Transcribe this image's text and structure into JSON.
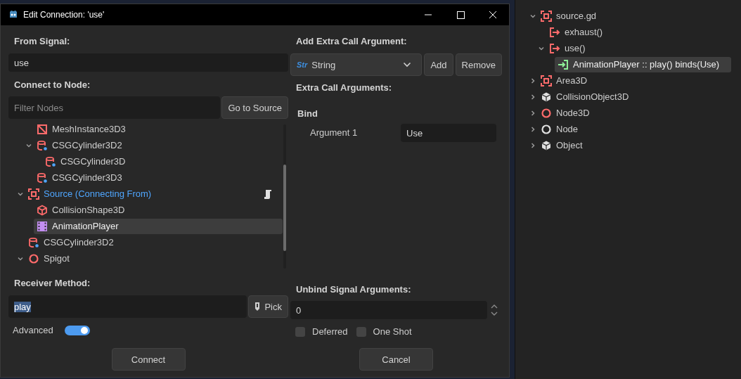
{
  "window": {
    "title": "Edit Connection: 'use'"
  },
  "from_signal": {
    "label": "From Signal:",
    "value": "use"
  },
  "connect_to_node": {
    "label": "Connect to Node:",
    "placeholder": "Filter Nodes",
    "go_to_source": "Go to Source"
  },
  "node_tree": {
    "items": [
      {
        "children": [
          {
            "label": "MeshInstance3D3",
            "kind": "mesh",
            "selected": false,
            "connecting_from": false,
            "has_script": false
          },
          {
            "label": "CSGCylinder3D2",
            "kind": "cylinder",
            "selected": false,
            "connecting_from": false,
            "has_script": false,
            "expanded": true,
            "children": [
              {
                "label": "CSGCylinder3D",
                "kind": "cylinder",
                "selected": false,
                "connecting_from": false,
                "has_script": false
              }
            ]
          },
          {
            "label": "CSGCylinder3D3",
            "kind": "cylinder",
            "selected": false,
            "connecting_from": false,
            "has_script": false
          }
        ]
      },
      {
        "label": "Source (Connecting From)",
        "kind": "area",
        "selected": false,
        "connecting_from": true,
        "has_script": true,
        "expanded": true,
        "children": [
          {
            "label": "CollisionShape3D",
            "kind": "shape",
            "selected": false,
            "connecting_from": false,
            "has_script": false
          },
          {
            "label": "AnimationPlayer",
            "kind": "animation",
            "selected": true,
            "connecting_from": false,
            "has_script": false
          }
        ]
      },
      {
        "label": "CSGCylinder3D2",
        "kind": "cylinder",
        "selected": false,
        "connecting_from": false,
        "has_script": false
      },
      {
        "label": "Spigot",
        "kind": "node3d",
        "selected": false,
        "connecting_from": false,
        "has_script": false,
        "expanded": true
      }
    ]
  },
  "receiver_method": {
    "label": "Receiver Method:",
    "value": "play",
    "pick": "Pick"
  },
  "advanced": {
    "label": "Advanced",
    "on": true
  },
  "add_extra_argument": {
    "label": "Add Extra Call Argument:",
    "type_icon": "Str",
    "type": "String",
    "add": "Add",
    "remove": "Remove"
  },
  "extra_arguments": {
    "label": "Extra Call Arguments:",
    "group": "Bind",
    "args": [
      {
        "name": "Argument 1",
        "value": "Use"
      }
    ]
  },
  "unbind": {
    "label": "Unbind Signal Arguments:",
    "value": "0"
  },
  "options": [
    {
      "label": "Deferred",
      "checked": false
    },
    {
      "label": "One Shot",
      "checked": false
    }
  ],
  "buttons": [
    "Connect",
    "Cancel"
  ],
  "signal_tree": {
    "items": [
      {
        "label": "source.gd",
        "kind": "area",
        "selected": false,
        "expanded": true,
        "children": [
          {
            "label": "exhaust()",
            "kind": "signal",
            "selected": false
          },
          {
            "label": "use()",
            "kind": "signal",
            "selected": false,
            "expanded": true,
            "children": [
              {
                "label": "AnimationPlayer :: play() binds(Use)",
                "kind": "connection",
                "selected": true
              }
            ]
          }
        ]
      },
      {
        "label": "Area3D",
        "kind": "area",
        "selected": false,
        "expanded": false
      },
      {
        "label": "CollisionObject3D",
        "kind": "object",
        "selected": false,
        "expanded": false
      },
      {
        "label": "Node3D",
        "kind": "node3d",
        "selected": false,
        "expanded": false
      },
      {
        "label": "Node",
        "kind": "node",
        "selected": false,
        "expanded": false
      },
      {
        "label": "Object",
        "kind": "object",
        "selected": false,
        "expanded": false
      }
    ]
  }
}
